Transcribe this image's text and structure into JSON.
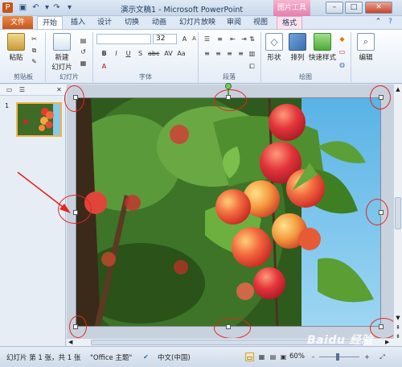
{
  "window": {
    "title": "演示文稿1 - Microsoft PowerPoint",
    "context_tab_title": "图片工具",
    "controls": {
      "minimize": "–",
      "maximize": "□",
      "close": "✕"
    }
  },
  "tabs": [
    "文件",
    "开始",
    "插入",
    "设计",
    "切换",
    "动画",
    "幻灯片放映",
    "审阅",
    "视图",
    "格式"
  ],
  "ribbon": {
    "clipboard": {
      "paste": "粘贴",
      "label": "剪贴板"
    },
    "slides": {
      "new_slide_line1": "新建",
      "new_slide_line2": "幻灯片",
      "label": "幻灯片"
    },
    "font": {
      "size": "32",
      "label": "字体"
    },
    "paragraph": {
      "label": "段落"
    },
    "drawing": {
      "shape": "形状",
      "arrange": "排列",
      "quick_style": "快速样式",
      "label": "绘图"
    },
    "editing": {
      "edit": "编辑"
    }
  },
  "slide_pane": {
    "slide_number": "1"
  },
  "status": {
    "slide_info": "幻灯片 第 1 张，共 1 张",
    "theme": "\"Office 主题\"",
    "language": "中文(中国)",
    "zoom": "60%"
  },
  "watermark": "Baidu 经验",
  "colors": {
    "annotation": "#e52520",
    "file_tab": "#c9541b",
    "context_tab": "#e47fae"
  }
}
